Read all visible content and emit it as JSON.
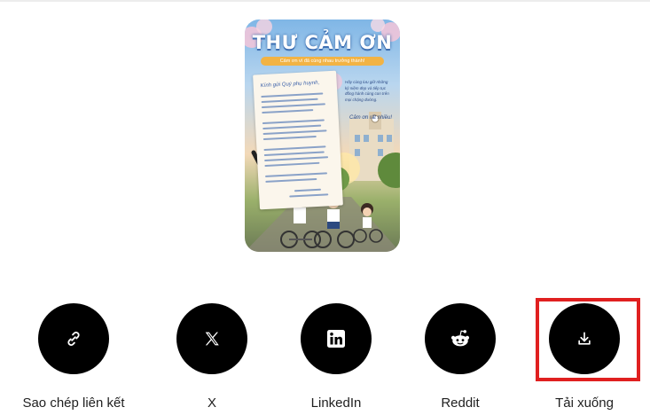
{
  "poster": {
    "title": "THƯ CẢM ƠN",
    "subtitle": "Cảm ơn vì đã cùng nhau trưởng thành!",
    "letter_greeting": "Kính gửi Quý phụ huynh,",
    "side_note": "Hãy cùng lưu giữ những kỷ niệm đẹp và tiếp tục đồng hành cùng con trên mọi chặng đường.",
    "side_note_sign": "Cảm ơn rất nhiều!"
  },
  "share": {
    "items": [
      {
        "label": "Sao chép liên kết",
        "icon": "link-icon"
      },
      {
        "label": "X",
        "icon": "x-logo-icon"
      },
      {
        "label": "LinkedIn",
        "icon": "linkedin-icon"
      },
      {
        "label": "Reddit",
        "icon": "reddit-icon"
      },
      {
        "label": "Tải xuống",
        "icon": "download-icon"
      }
    ],
    "highlighted": "Tải xuống",
    "highlight_color": "#e02020",
    "button_color": "#000000"
  }
}
